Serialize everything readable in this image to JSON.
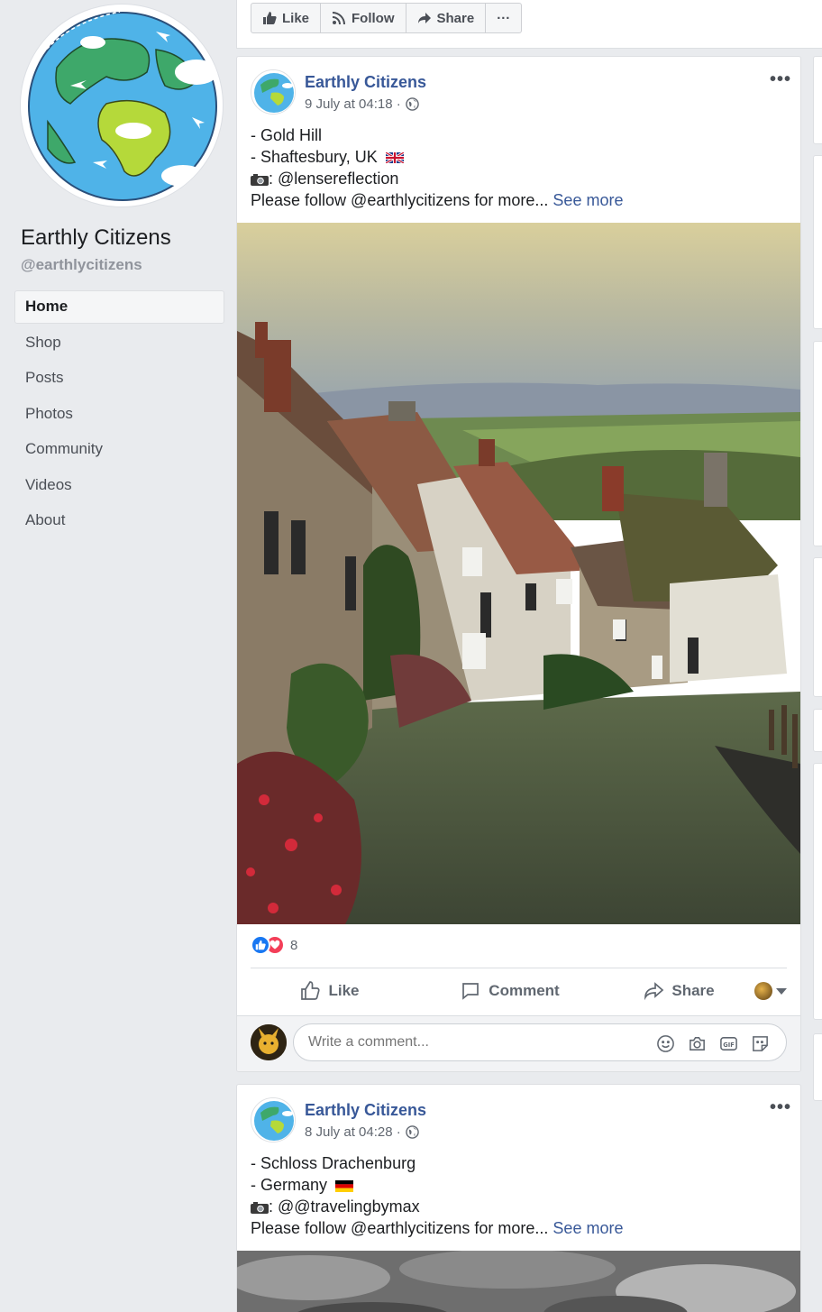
{
  "page": {
    "name": "Earthly Citizens",
    "handle": "@earthlycitizens"
  },
  "nav": {
    "items": [
      {
        "label": "Home",
        "active": true
      },
      {
        "label": "Shop"
      },
      {
        "label": "Posts"
      },
      {
        "label": "Photos"
      },
      {
        "label": "Community"
      },
      {
        "label": "Videos"
      },
      {
        "label": "About"
      }
    ]
  },
  "toolbar": {
    "like_label": "Like",
    "follow_label": "Follow",
    "share_label": "Share",
    "more_label": "···"
  },
  "posts": [
    {
      "author": "Earthly Citizens",
      "timestamp": "9 July at 04:18 ·",
      "privacy_icon": "globe-icon",
      "lines": [
        "- Gold Hill",
        "- Shaftesbury, UK"
      ],
      "flag": "uk-flag-icon",
      "credit": ": @lensereflection",
      "follow_text": "Please follow @earthlycitizens for more...",
      "see_more": "See more",
      "reaction_count": "8",
      "actions": {
        "like": "Like",
        "comment": "Comment",
        "share": "Share"
      },
      "comment_placeholder": "Write a comment..."
    },
    {
      "author": "Earthly Citizens",
      "timestamp": "8 July at 04:28 ·",
      "privacy_icon": "globe-icon",
      "lines": [
        "- Schloss Drachenburg",
        "- Germany"
      ],
      "flag": "germany-flag-icon",
      "credit": ": @@travelingbymax",
      "follow_text": "Please follow @earthlycitizens for more...",
      "see_more": "See more"
    }
  ],
  "colors": {
    "link": "#385898",
    "background": "#e9ebee",
    "like_blue": "#1877f2",
    "love_red": "#f33e58"
  }
}
